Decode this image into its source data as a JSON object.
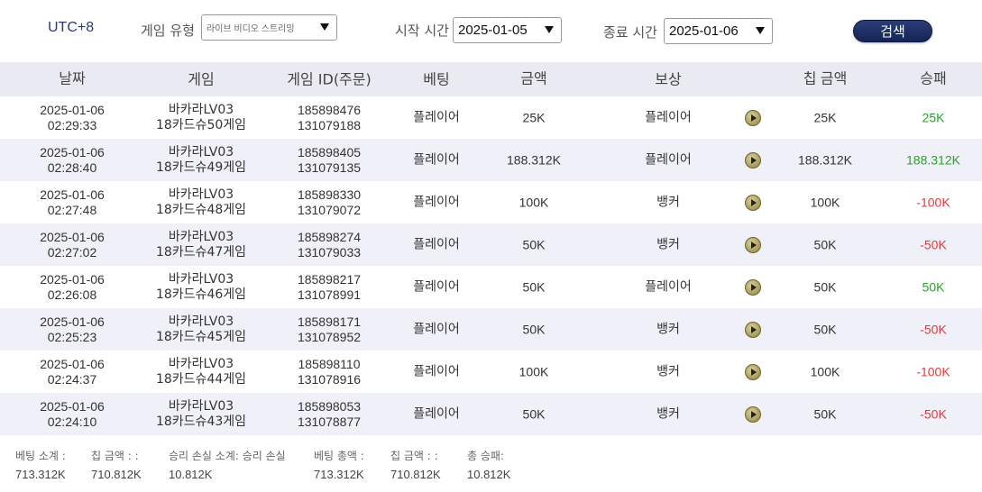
{
  "filters": {
    "timezone": "UTC+8",
    "game_type_label": "게임 유형",
    "game_type_value": "라이브 비디오 스트리밍",
    "start_label": "시작 시간",
    "start_value": "2025-01-05",
    "end_label": "종료 시간",
    "end_value": "2025-01-06",
    "search_label": "검색"
  },
  "table": {
    "headers": [
      "날짜",
      "게임",
      "게임 ID(주문)",
      "베팅",
      "금액",
      "보상",
      "칩 금액",
      "승패"
    ],
    "rows": [
      {
        "date": "2025-01-06",
        "time": "02:29:33",
        "game1": "바카라LV03",
        "game2": "18카드슈50게임",
        "id1": "185898476",
        "id2": "131079188",
        "bet": "플레이어",
        "amount": "25K",
        "reward": "플레이어",
        "tip": "25K",
        "wl": "25K",
        "wl_sign": "pos"
      },
      {
        "date": "2025-01-06",
        "time": "02:28:40",
        "game1": "바카라LV03",
        "game2": "18카드슈49게임",
        "id1": "185898405",
        "id2": "131079135",
        "bet": "플레이어",
        "amount": "188.312K",
        "reward": "플레이어",
        "tip": "188.312K",
        "wl": "188.312K",
        "wl_sign": "pos"
      },
      {
        "date": "2025-01-06",
        "time": "02:27:48",
        "game1": "바카라LV03",
        "game2": "18카드슈48게임",
        "id1": "185898330",
        "id2": "131079072",
        "bet": "플레이어",
        "amount": "100K",
        "reward": "뱅커",
        "tip": "100K",
        "wl": "-100K",
        "wl_sign": "neg"
      },
      {
        "date": "2025-01-06",
        "time": "02:27:02",
        "game1": "바카라LV03",
        "game2": "18카드슈47게임",
        "id1": "185898274",
        "id2": "131079033",
        "bet": "플레이어",
        "amount": "50K",
        "reward": "뱅커",
        "tip": "50K",
        "wl": "-50K",
        "wl_sign": "neg"
      },
      {
        "date": "2025-01-06",
        "time": "02:26:08",
        "game1": "바카라LV03",
        "game2": "18카드슈46게임",
        "id1": "185898217",
        "id2": "131078991",
        "bet": "플레이어",
        "amount": "50K",
        "reward": "플레이어",
        "tip": "50K",
        "wl": "50K",
        "wl_sign": "pos"
      },
      {
        "date": "2025-01-06",
        "time": "02:25:23",
        "game1": "바카라LV03",
        "game2": "18카드슈45게임",
        "id1": "185898171",
        "id2": "131078952",
        "bet": "플레이어",
        "amount": "50K",
        "reward": "뱅커",
        "tip": "50K",
        "wl": "-50K",
        "wl_sign": "neg"
      },
      {
        "date": "2025-01-06",
        "time": "02:24:37",
        "game1": "바카라LV03",
        "game2": "18카드슈44게임",
        "id1": "185898110",
        "id2": "131078916",
        "bet": "플레이어",
        "amount": "100K",
        "reward": "뱅커",
        "tip": "100K",
        "wl": "-100K",
        "wl_sign": "neg"
      },
      {
        "date": "2025-01-06",
        "time": "02:24:10",
        "game1": "바카라LV03",
        "game2": "18카드슈43게임",
        "id1": "185898053",
        "id2": "131078877",
        "bet": "플레이어",
        "amount": "50K",
        "reward": "뱅커",
        "tip": "50K",
        "wl": "-50K",
        "wl_sign": "neg"
      }
    ],
    "play_icon": "play-icon"
  },
  "summary": {
    "items": [
      {
        "label": "베팅 소계 :",
        "value": "713.312K"
      },
      {
        "label": "칩 금액 : :",
        "value": "710.812K"
      },
      {
        "label": "승리 손실 소계: 승리 손실",
        "value": "10.812K"
      },
      {
        "label": "베팅 총액 :",
        "value": "713.312K"
      },
      {
        "label": "칩 금액 : :",
        "value": "710.812K"
      },
      {
        "label": "총 승패:",
        "value": "10.812K"
      }
    ]
  },
  "colors": {
    "positive": "#2aa22a",
    "negative": "#e23b3b",
    "header_bg": "#eaeaf3",
    "button": "#1c2c62"
  }
}
